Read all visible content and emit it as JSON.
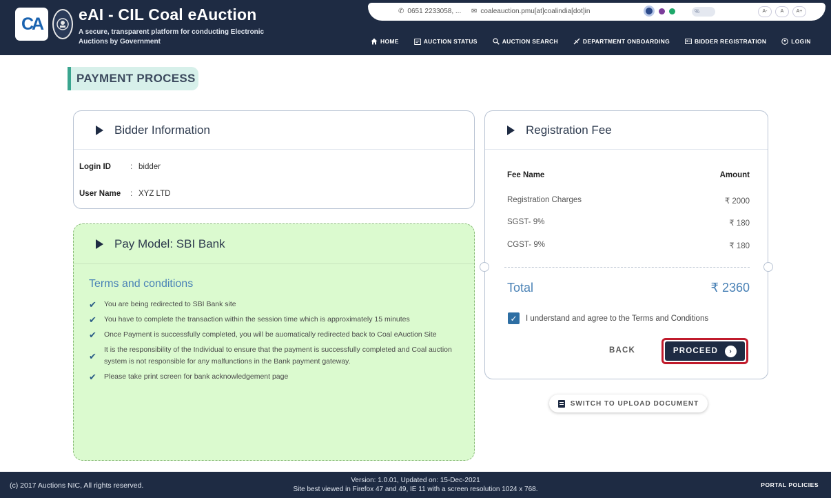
{
  "header": {
    "logo_text": "CA",
    "title": "eAI - CIL Coal eAuction",
    "subtitle": "A secure, transparent platform for conducting Electronic Auctions by Government",
    "phone": "0651 2233058, ...",
    "email": "coaleauction.pmu[at]coalindia[dot]in",
    "font_sizes": [
      "A-",
      "A",
      "A+"
    ],
    "toggle_label": "%",
    "theme_colors": [
      "#2c4a8a",
      "#7b3c9a",
      "#1ea86a"
    ]
  },
  "nav": [
    {
      "label": "HOME",
      "icon": "home-icon"
    },
    {
      "label": "AUCTION STATUS",
      "icon": "calendar-icon"
    },
    {
      "label": "AUCTION SEARCH",
      "icon": "search-icon"
    },
    {
      "label": "DEPARTMENT ONBOARDING",
      "icon": "link-icon"
    },
    {
      "label": "BIDDER REGISTRATION",
      "icon": "id-card-icon"
    },
    {
      "label": "LOGIN",
      "icon": "login-icon"
    }
  ],
  "page_title": "PAYMENT PROCESS",
  "bidder": {
    "heading": "Bidder Information",
    "login_label": "Login ID",
    "login_value": "bidder",
    "user_label": "User Name",
    "user_value": "XYZ LTD",
    "separator": ":"
  },
  "pay": {
    "heading": "Pay Model: SBI Bank",
    "terms_title": "Terms and conditions",
    "terms": [
      "You are being redirected to SBI Bank site",
      "You have to complete the transaction within the session time which is approximately 15 minutes",
      "Once Payment is successfully completed, you will be auomatically redirected back to Coal eAuction Site",
      "It is the responsibility of the Individual to ensure that the payment is successfully completed and Coal auction system is not responsible for any malfunctions in the Bank payment gateway.",
      "Please take print screen for bank acknowledgement page"
    ]
  },
  "registration": {
    "heading": "Registration Fee",
    "col_name": "Fee Name",
    "col_amount": "Amount",
    "fees": [
      {
        "name": "Registration Charges",
        "amount": "₹ 2000"
      },
      {
        "name": "SGST- 9%",
        "amount": "₹ 180"
      },
      {
        "name": "CGST- 9%",
        "amount": "₹ 180"
      }
    ],
    "total_label": "Total",
    "total_value": "₹ 2360",
    "agree_text": "I understand and agree to the Terms and Conditions",
    "back_label": "BACK",
    "proceed_label": "PROCEED"
  },
  "switch_label": "SWITCH TO UPLOAD DOCUMENT",
  "footer": {
    "copyright": "(c) 2017 Auctions NIC, All rights reserved.",
    "version": "Version: 1.0.01, Updated on: 15-Dec-2021",
    "best_viewed": "Site best viewed in Firefox 47 and 49, IE 11 with a screen resolution 1024 x 768.",
    "policies": "PORTAL POLICIES"
  }
}
